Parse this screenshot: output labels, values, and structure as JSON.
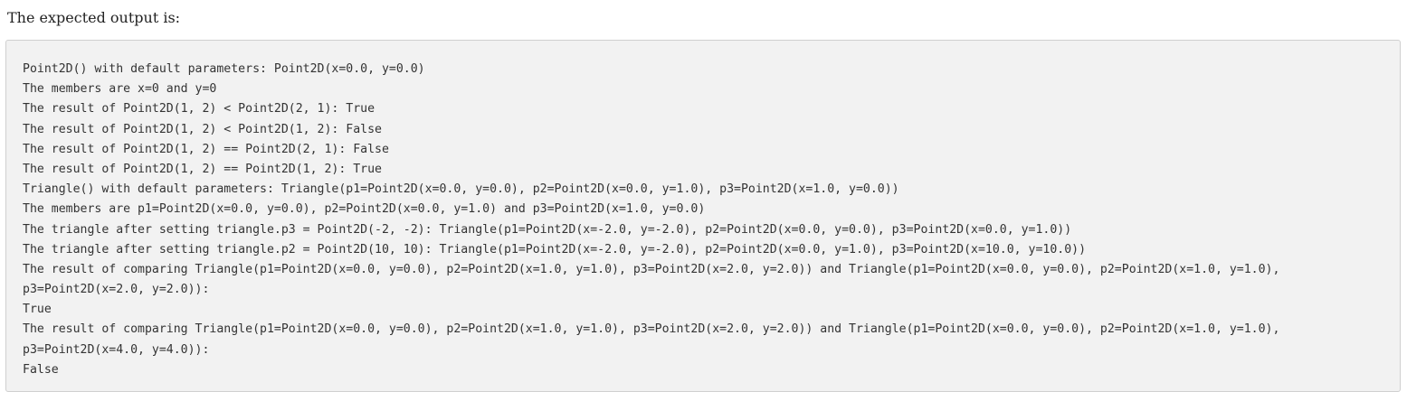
{
  "intro": {
    "text": "The expected output is:"
  },
  "output": {
    "lines": [
      "Point2D() with default parameters: Point2D(x=0.0, y=0.0)",
      "The members are x=0 and y=0",
      "The result of Point2D(1, 2) < Point2D(2, 1): True",
      "The result of Point2D(1, 2) < Point2D(1, 2): False",
      "The result of Point2D(1, 2) == Point2D(2, 1): False",
      "The result of Point2D(1, 2) == Point2D(1, 2): True",
      "Triangle() with default parameters: Triangle(p1=Point2D(x=0.0, y=0.0), p2=Point2D(x=0.0, y=1.0), p3=Point2D(x=1.0, y=0.0))",
      "The members are p1=Point2D(x=0.0, y=0.0), p2=Point2D(x=0.0, y=1.0) and p3=Point2D(x=1.0, y=0.0)",
      "The triangle after setting triangle.p3 = Point2D(-2, -2): Triangle(p1=Point2D(x=-2.0, y=-2.0), p2=Point2D(x=0.0, y=0.0), p3=Point2D(x=0.0, y=1.0))",
      "The triangle after setting triangle.p2 = Point2D(10, 10): Triangle(p1=Point2D(x=-2.0, y=-2.0), p2=Point2D(x=0.0, y=1.0), p3=Point2D(x=10.0, y=10.0))",
      "The result of comparing Triangle(p1=Point2D(x=0.0, y=0.0), p2=Point2D(x=1.0, y=1.0), p3=Point2D(x=2.0, y=2.0)) and Triangle(p1=Point2D(x=0.0, y=0.0), p2=Point2D(x=1.0, y=1.0),",
      "p3=Point2D(x=2.0, y=2.0)):",
      "True",
      "The result of comparing Triangle(p1=Point2D(x=0.0, y=0.0), p2=Point2D(x=1.0, y=1.0), p3=Point2D(x=2.0, y=2.0)) and Triangle(p1=Point2D(x=0.0, y=0.0), p2=Point2D(x=1.0, y=1.0),",
      "p3=Point2D(x=4.0, y=4.0)):",
      "False"
    ]
  }
}
